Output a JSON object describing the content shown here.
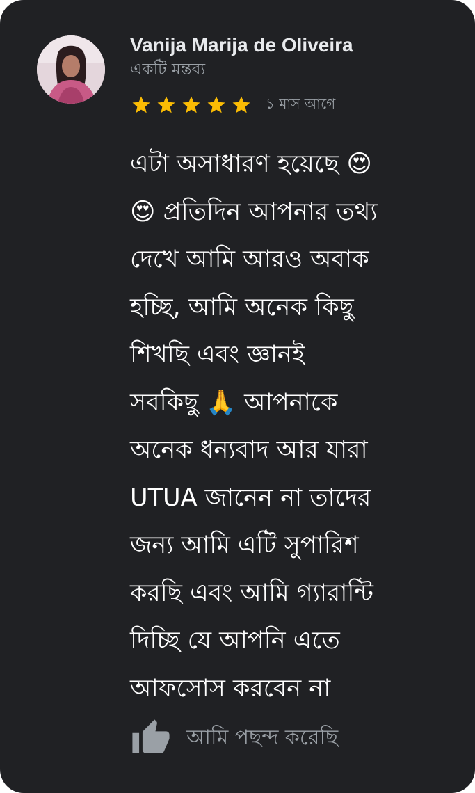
{
  "review": {
    "author": "Vanija Marija de Oliveira",
    "subtitle": "একটি মন্তব্য",
    "rating": 5,
    "rating_max": 5,
    "star_color": "#fbbc04",
    "time": "১ মাস আগে",
    "text_lines": [
      "এটা অসাধারণ হয়েছে 😍",
      "😍 প্রতিদিন আপনার তথ্য",
      "দেখে আমি আরও অবাক",
      "হচ্ছি, আমি অনেক কিছু",
      "শিখছি এবং জ্ঞানই",
      "সবকিছু 🙏 আপনাকে",
      "অনেক ধন্যবাদ  আর যারা",
      "UTUA জানেন না তাদের",
      "জন্য আমি এটি সুপারিশ",
      "করছি এবং আমি গ্যারান্টি",
      "দিচ্ছি যে আপনি এতে",
      "আফসোস করবেন না"
    ],
    "like_icon": "thumbs-up-icon",
    "like_label": "আমি পছন্দ করেছি"
  },
  "colors": {
    "card_background": "#202124",
    "author_text": "#e8eaed",
    "secondary_text": "#9aa0a6",
    "body_text": "#ffffff",
    "star": "#fbbc04"
  }
}
